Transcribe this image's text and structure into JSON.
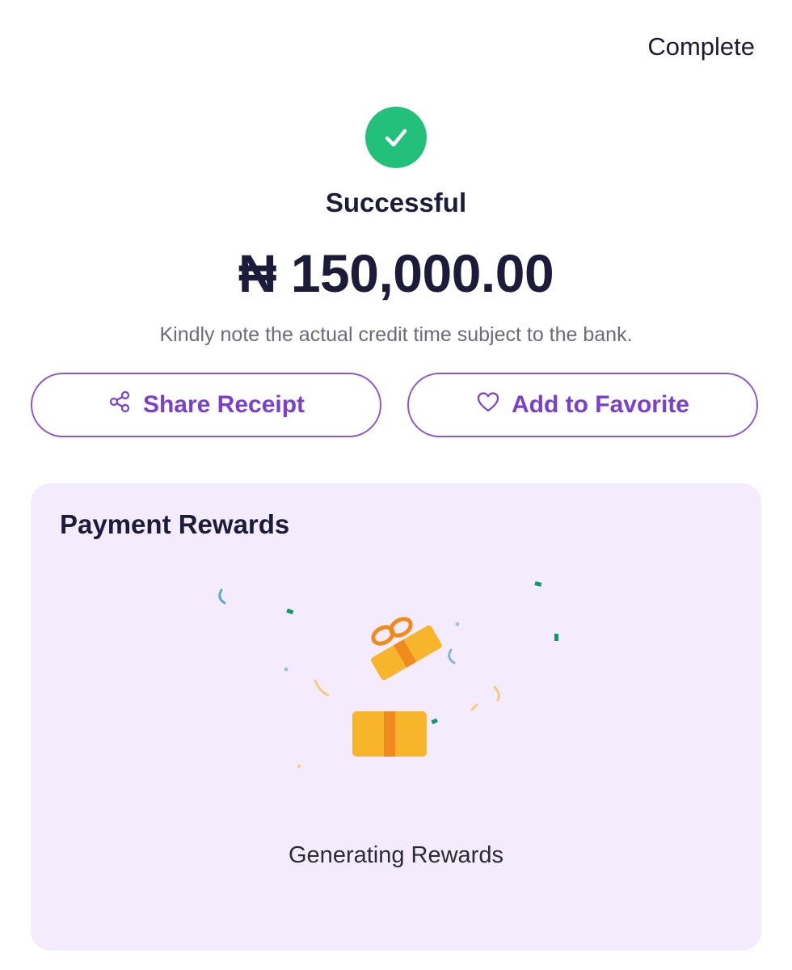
{
  "header": {
    "complete_label": "Complete"
  },
  "result": {
    "status": "Successful",
    "amount": "₦ 150,000.00",
    "note": "Kindly note the actual credit time subject to the bank."
  },
  "actions": {
    "share_label": "Share Receipt",
    "favorite_label": "Add to Favorite"
  },
  "rewards": {
    "title": "Payment Rewards",
    "status": "Generating Rewards"
  },
  "icons": {
    "success": "check-circle-icon",
    "share": "share-icon",
    "favorite": "heart-icon",
    "gift": "gift-icon"
  },
  "colors": {
    "success": "#22c07a",
    "accent": "#7b3fd0",
    "card_background": "#f4ecfd",
    "gift": "#f7b52c"
  }
}
